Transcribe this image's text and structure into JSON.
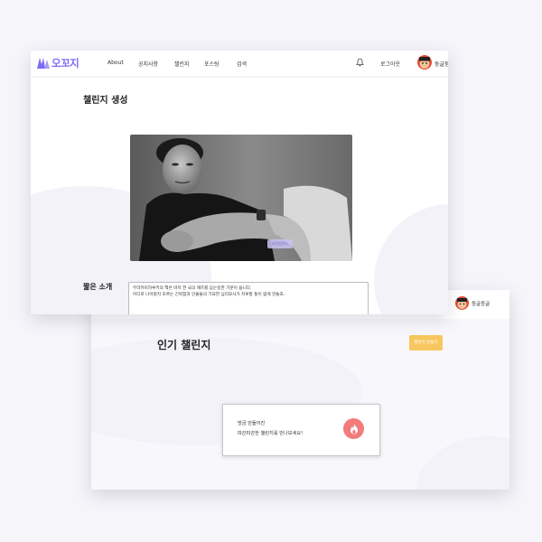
{
  "window_top": {
    "logo_text": "오꼬지",
    "nav": {
      "items": [
        {
          "label": "About"
        },
        {
          "label": "공지사항"
        },
        {
          "label": "챌린지"
        },
        {
          "label": "포스팅"
        },
        {
          "label": "검색"
        }
      ],
      "logout_label": "로그아웃",
      "username": "둥글둥"
    },
    "page_title": "챌린지 생성",
    "photo_button_label": "사진업로드",
    "intro_label": "짧은 소개",
    "intro_text": [
      "무라카미하루키의 책은 마치 한 국의 재즈를 듣는듯한 기분이 듭니다.",
      "어디로 나아갈지 모르는 긴박함과 인물들의 기묘한 심리묘사가 지루할 틈이 없게 만들죠."
    ]
  },
  "window_bottom": {
    "username": "둥글둥글",
    "section_title": "인기 챌린지",
    "create_button_label": "챌린지 만들기",
    "card_lines": [
      "방금 만들어진",
      "따끈따끈한 챌린지를 만나보세요!"
    ]
  },
  "colors": {
    "brand": "#7b6cf6",
    "create_button": "#f7c65e",
    "fire_badge": "#f27c7c"
  },
  "icons": [
    "logo-icon",
    "bell-icon",
    "avatar",
    "fire-icon"
  ]
}
